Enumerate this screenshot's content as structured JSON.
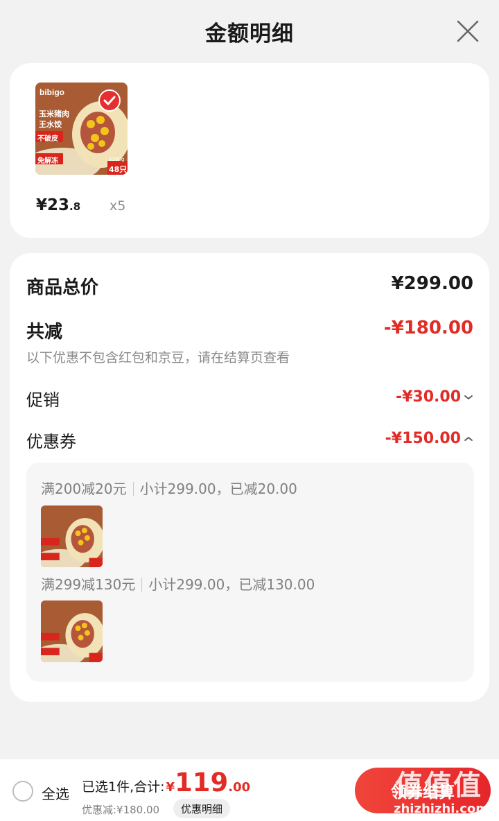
{
  "header": {
    "title": "金额明细"
  },
  "product": {
    "price_int": "¥23",
    "price_dec": ".8",
    "quantity": "x5",
    "thumb": {
      "brand": "bibigo",
      "name_line1": "玉米猪肉",
      "name_line2": "王水饺",
      "tag1": "不破皮",
      "tag2": "免解冻",
      "weight": "1200g",
      "count": "48只"
    }
  },
  "summary": {
    "total_label": "商品总价",
    "total_value": "¥299.00",
    "reduce_label": "共减",
    "reduce_value": "-¥180.00",
    "note": "以下优惠不包含红包和京豆，请在结算页查看",
    "promo_label": "促销",
    "promo_value": "-¥30.00",
    "coupon_label": "优惠券",
    "coupon_value": "-¥150.00"
  },
  "coupons": [
    {
      "rule": "满200减20元",
      "detail": "小计299.00，已减20.00"
    },
    {
      "rule": "满299减130元",
      "detail": "小计299.00，已减130.00"
    }
  ],
  "bottom": {
    "select_all": "全选",
    "selected_label": "已选1件,合计:",
    "total_yen": "¥",
    "total_int": "119",
    "total_dec": ".00",
    "discount_text": "优惠减:¥180.00",
    "detail_chip": "优惠明细",
    "checkout": "领券结算"
  },
  "watermark": {
    "logo": "值值值",
    "site": "zhizhizhi.com"
  },
  "colors": {
    "accent_red": "#e22b25",
    "background": "#f2f2f2"
  }
}
